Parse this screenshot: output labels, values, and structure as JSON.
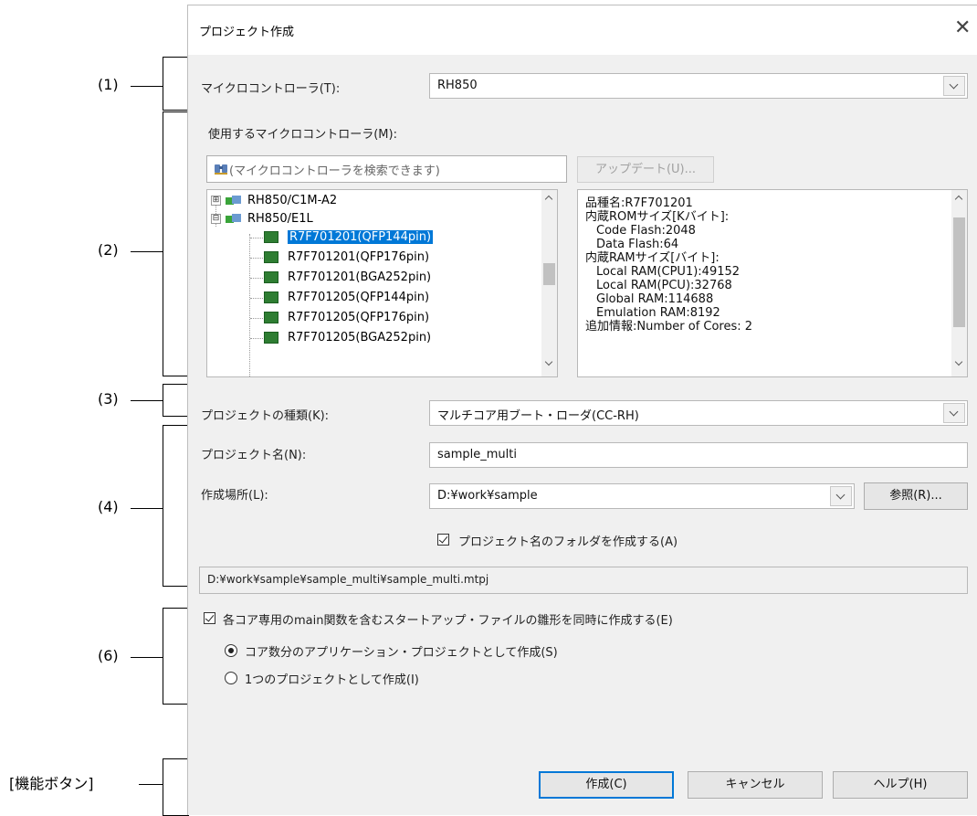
{
  "callouts": {
    "c1": "(1)",
    "c2": "(2)",
    "c3": "(3)",
    "c4": "(4)",
    "c6": "(6)",
    "buttons": "[機能ボタン]"
  },
  "dialog": {
    "title": "プロジェクト作成",
    "close_symbol": "✕"
  },
  "microcontroller": {
    "label": "マイクロコントローラ(T):",
    "value": "RH850"
  },
  "mcu_select": {
    "label": "使用するマイクロコントローラ(M):",
    "search_placeholder": "(マイクロコントローラを検索できます)",
    "update_button": "アップデート(U)...",
    "tree": [
      {
        "expander": "⊞",
        "label": "RH850/C1M-A2"
      },
      {
        "expander": "⊟",
        "label": "RH850/E1L"
      }
    ],
    "devices": [
      "R7F701201(QFP144pin)",
      "R7F701201(QFP176pin)",
      "R7F701201(BGA252pin)",
      "R7F701205(QFP144pin)",
      "R7F701205(QFP176pin)",
      "R7F701205(BGA252pin)"
    ],
    "selected_device_index": 0,
    "info_lines": [
      "品種名:R7F701201",
      "内蔵ROMサイズ[Kバイト]:",
      "Code Flash:2048",
      "Data Flash:64",
      "内蔵RAMサイズ[バイト]:",
      "Local RAM(CPU1):49152",
      "Local RAM(PCU):32768",
      "Global RAM:114688",
      "Emulation RAM:8192",
      "追加情報:Number of Cores: 2"
    ]
  },
  "project_type": {
    "label": "プロジェクトの種類(K):",
    "value": "マルチコア用ブート・ローダ(CC-RH)"
  },
  "project_name": {
    "label": "プロジェクト名(N):",
    "value": "sample_multi"
  },
  "location": {
    "label": "作成場所(L):",
    "value": "D:¥work¥sample",
    "browse_button": "参照(R)..."
  },
  "create_folder": {
    "label": "プロジェクト名のフォルダを作成する(A)",
    "checked": true
  },
  "full_path": "D:¥work¥sample¥sample_multi¥sample_multi.mtpj",
  "startup": {
    "label": "各コア専用のmain関数を含むスタートアップ・ファイルの雛形を同時に作成する(E)",
    "checked": true,
    "options": [
      {
        "label": "コア数分のアプリケーション・プロジェクトとして作成(S)",
        "selected": true
      },
      {
        "label": "1つのプロジェクトとして作成(I)",
        "selected": false
      }
    ]
  },
  "buttons": {
    "create": "作成(C)",
    "cancel": "キャンセル",
    "help": "ヘルプ(H)"
  }
}
